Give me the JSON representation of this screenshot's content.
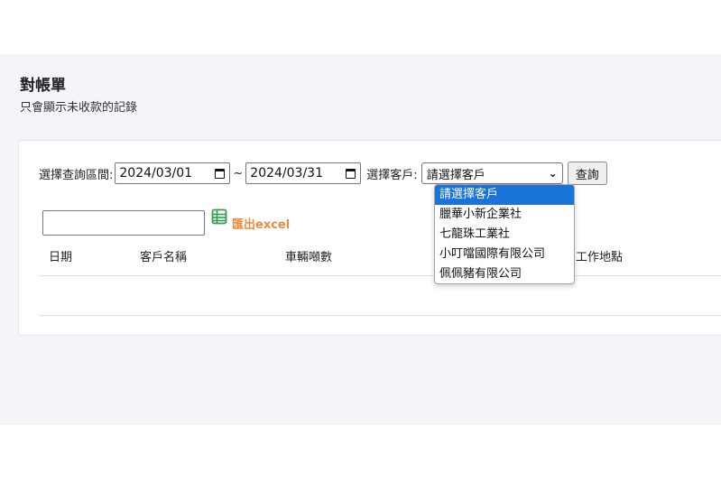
{
  "page": {
    "title": "對帳單",
    "subtitle": "只會顯示未收款的記錄"
  },
  "filter": {
    "date_range_label": "選擇查詢區間:",
    "start_date": "2024/03/01",
    "separator": "~",
    "end_date": "2024/03/31",
    "customer_label": "選擇客戶:",
    "customer_selected": "請選擇客戶",
    "query_button": "查詢"
  },
  "export": {
    "label": "匯出excel",
    "icon": "spreadsheet-icon",
    "color": "#f0883e"
  },
  "table": {
    "columns": [
      "日期",
      "客戶名稱",
      "車輛噸數",
      "工作地點"
    ]
  },
  "dropdown": {
    "options": [
      "請選擇客戶",
      "臘華小新企業社",
      "七龍珠工業社",
      "小叮噹國際有限公司",
      "佩佩豬有限公司"
    ],
    "selected_index": 0,
    "highlight_color": "#1a73d9"
  }
}
